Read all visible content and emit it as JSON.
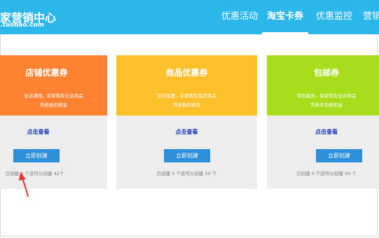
{
  "header": {
    "logo_main": "家营销中心",
    "logo_sub": ".taobao.com",
    "nav": [
      {
        "label": "优惠活动",
        "active": false
      },
      {
        "label": "淘宝卡券",
        "active": true
      },
      {
        "label": "优惠监控",
        "active": false
      },
      {
        "label": "营销",
        "active": false
      }
    ]
  },
  "cards": [
    {
      "title": "店铺优惠券",
      "desc_line1": "全店通用，买家购买全店商品",
      "desc_line2": "凭券抵扣现金",
      "link": "点击查看",
      "button": "立即创建",
      "note": "已创建 8 个还可以创建 42个",
      "color": "#fd8232"
    },
    {
      "title": "商品优惠券",
      "desc_line1": "定向优惠，买家购买指定商品",
      "desc_line2": "凭券抵扣现金",
      "link": "点击查看",
      "button": "立即创建",
      "note": "已创建 0 个还可以创建 50 个",
      "color": "#fdc02b"
    },
    {
      "title": "包邮券",
      "desc_line1": "特色服务，买家购买全店商品",
      "desc_line2": "凭券享包邮权益",
      "link": "点击查看",
      "button": "立即创建",
      "note": "已创建 0 个还可以创建 50 个",
      "color": "#a7dd1b"
    }
  ],
  "colors": {
    "header": "#2cb7eb",
    "button": "#2d8fd8",
    "link": "#1a3bb6",
    "arrow": "#e8352f"
  }
}
